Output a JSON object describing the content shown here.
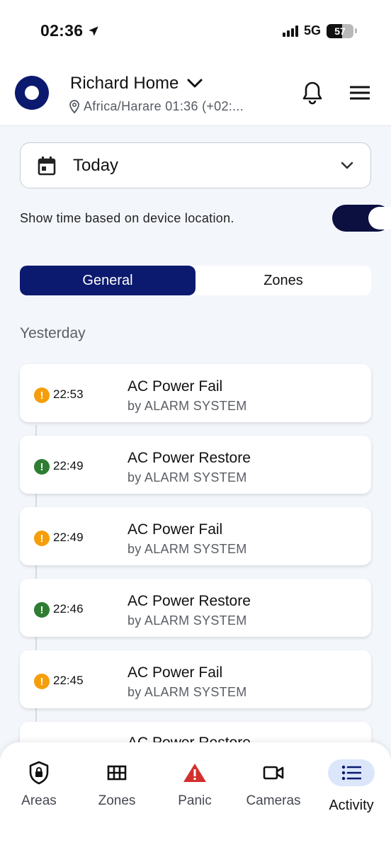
{
  "status_bar": {
    "time": "02:36",
    "network": "5G",
    "battery": "57"
  },
  "header": {
    "home_name": "Richard Home",
    "timezone": "Africa/Harare 01:36 (+02:..."
  },
  "date_filter": {
    "selected": "Today"
  },
  "device_time_toggle": {
    "label": "Show time based on device location.",
    "on": true
  },
  "tabs": [
    {
      "label": "General",
      "active": true
    },
    {
      "label": "Zones",
      "active": false
    }
  ],
  "section_label": "Yesterday",
  "colors": {
    "primary": "#0b1a6e",
    "warning": "#f59e0b",
    "success": "#2e7d32",
    "panic": "#d32f2f"
  },
  "events": [
    {
      "time": "22:53",
      "title": "AC Power Fail",
      "by": "by ALARM SYSTEM",
      "status": "warning"
    },
    {
      "time": "22:49",
      "title": "AC Power Restore",
      "by": "by ALARM SYSTEM",
      "status": "success"
    },
    {
      "time": "22:49",
      "title": "AC Power Fail",
      "by": "by ALARM SYSTEM",
      "status": "warning"
    },
    {
      "time": "22:46",
      "title": "AC Power Restore",
      "by": "by ALARM SYSTEM",
      "status": "success"
    },
    {
      "time": "22:45",
      "title": "AC Power Fail",
      "by": "by ALARM SYSTEM",
      "status": "warning"
    },
    {
      "time": "",
      "title": "AC Power Restore",
      "by": "",
      "status": "success"
    }
  ],
  "bottom_nav": [
    {
      "label": "Areas",
      "icon": "lock-shield-icon"
    },
    {
      "label": "Zones",
      "icon": "grid-icon"
    },
    {
      "label": "Panic",
      "icon": "warning-triangle-icon"
    },
    {
      "label": "Cameras",
      "icon": "video-camera-icon"
    },
    {
      "label": "Activity",
      "icon": "list-icon",
      "active": true
    }
  ]
}
